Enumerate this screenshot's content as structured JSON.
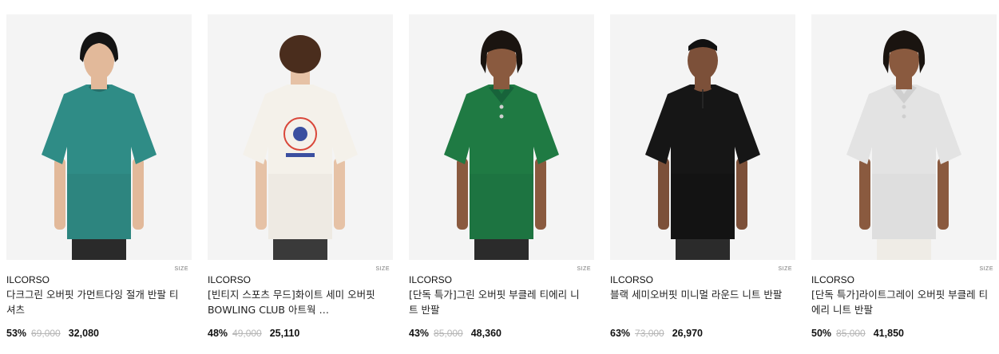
{
  "size_label": "SIZE",
  "products": [
    {
      "brand": "ILCORSO",
      "title": "다크그린 오버핏 가먼트다잉 절개 반팔 티셔츠",
      "discount": "53%",
      "original_price": "69,000",
      "sale_price": "32,080",
      "shirt_color": "#2f8c86",
      "shirt_shade": "#276f6a",
      "pants_color": "#2a2a2a",
      "hair_color": "#141414",
      "skin_color": "#e2b99a",
      "shirt_style": "tee-front"
    },
    {
      "brand": "ILCORSO",
      "title": "[빈티지 스포츠 무드]화이트 세미 오버핏 BOWLING CLUB 아트웍 …",
      "discount": "48%",
      "original_price": "49,000",
      "sale_price": "25,110",
      "shirt_color": "#f4f1ea",
      "shirt_shade": "#dcd8cf",
      "pants_color": "#3a3a3a",
      "hair_color": "#4a2d1d",
      "skin_color": "#e6c2a6",
      "shirt_style": "tee-back"
    },
    {
      "brand": "ILCORSO",
      "title": "[단독 특가]그린 오버핏 부클레 티에리 니트 반팔",
      "discount": "43%",
      "original_price": "85,000",
      "sale_price": "48,360",
      "shirt_color": "#1f7a43",
      "shirt_shade": "#17633a",
      "pants_color": "#2b2b2b",
      "hair_color": "#1a1410",
      "skin_color": "#8a5a3f",
      "shirt_style": "polo"
    },
    {
      "brand": "ILCORSO",
      "title": "블랙 세미오버핏 미니멀 라운드 니트 반팔",
      "discount": "63%",
      "original_price": "73,000",
      "sale_price": "26,970",
      "shirt_color": "#161616",
      "shirt_shade": "#0a0a0a",
      "pants_color": "#2b2b2b",
      "hair_color": "#111111",
      "skin_color": "#7c5039",
      "shirt_style": "henley"
    },
    {
      "brand": "ILCORSO",
      "title": "[단독 특가]라이트그레이 오버핏 부클레 티에리 니트 반팔",
      "discount": "50%",
      "original_price": "85,000",
      "sale_price": "41,850",
      "shirt_color": "#e3e3e3",
      "shirt_shade": "#cfcfcf",
      "pants_color": "#efece6",
      "hair_color": "#1a1410",
      "skin_color": "#8a5a3f",
      "shirt_style": "polo"
    }
  ]
}
